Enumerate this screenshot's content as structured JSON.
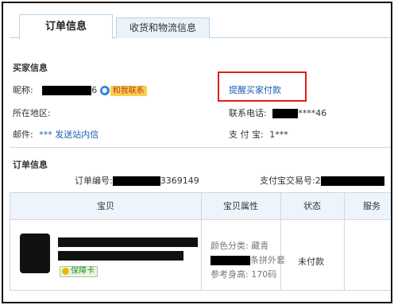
{
  "tabs": [
    {
      "label": "订单信息",
      "active": true
    },
    {
      "label": "收货和物流信息",
      "active": false
    }
  ],
  "buyer": {
    "title": "买家信息",
    "nickname_label": "昵称:",
    "nickname_suffix": "6",
    "contact_badge": "和我联系",
    "remind_link": "提醒买家付款",
    "region_label": "所在地区:",
    "phone_label": "联系电话:",
    "phone_suffix": "****46",
    "email_label": "邮件:",
    "email_value": "*** 发送站内信",
    "alipay_label": "支 付 宝:",
    "alipay_value": "1***"
  },
  "order": {
    "title": "订单信息",
    "number_label": "订单编号:",
    "number_suffix": "3369149",
    "alipay_tx_label": "支付宝交易号:",
    "alipay_tx_partial": "2"
  },
  "table": {
    "headers": [
      "宝贝",
      "宝贝属性",
      "状态",
      "服务"
    ],
    "guarantee_badge": "保障卡",
    "attr_color": "颜色分类: 藏青",
    "attr_style_suffix": "条拼外套",
    "attr_height": "参考身高: 170码",
    "status": "未付款"
  },
  "colors": {
    "link": "#1a5fb4",
    "highlight": "#e21b1b",
    "header_bg": "#edf4fb"
  }
}
